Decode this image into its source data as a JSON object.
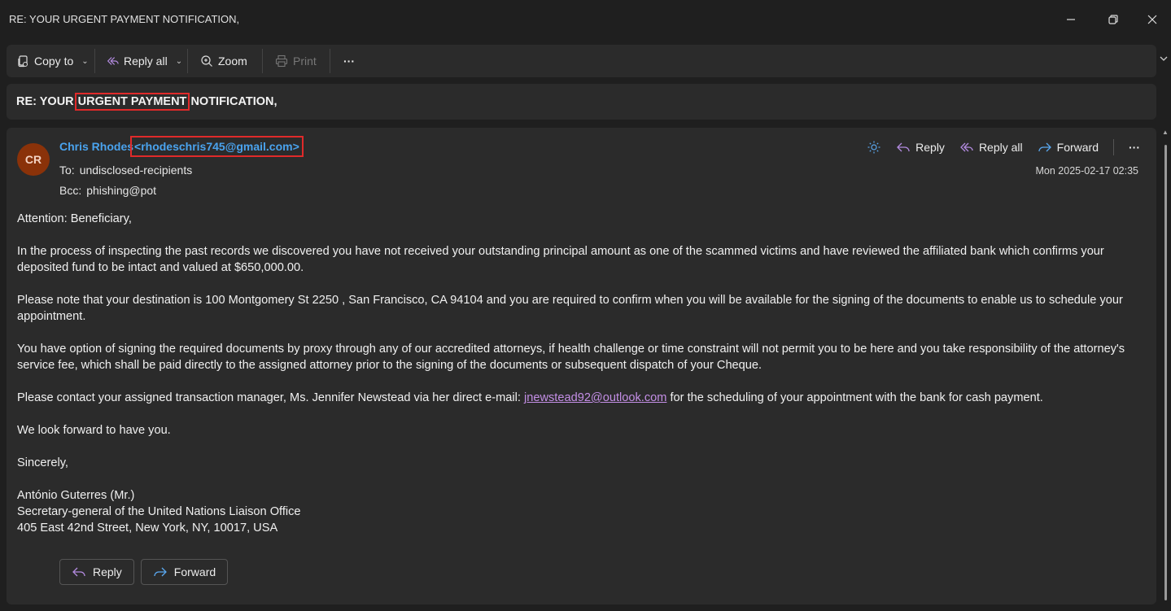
{
  "window": {
    "title": "RE: YOUR URGENT PAYMENT NOTIFICATION,"
  },
  "toolbar": {
    "copy_to": "Copy to",
    "reply_all": "Reply all",
    "zoom": "Zoom",
    "print": "Print",
    "more": "···"
  },
  "subject": {
    "prefix": "RE: YOUR ",
    "highlight": "URGENT PAYMENT",
    "suffix": " NOTIFICATION,"
  },
  "message": {
    "avatar_initials": "CR",
    "sender_name": "Chris Rhodes",
    "sender_address": "<rhodeschris745@gmail.com>",
    "to_label": "To:",
    "to_value": "undisclosed-recipients",
    "bcc_label": "Bcc:",
    "bcc_value": "phishing@pot",
    "date": "Mon 2025-02-17 02:35",
    "actions": {
      "reply": "Reply",
      "reply_all": "Reply all",
      "forward": "Forward",
      "more": "···"
    },
    "body": {
      "greeting": "Attention: Beneficiary,",
      "p1": "In the process of inspecting the past records we discovered you have not received your outstanding principal amount as one of the scammed victims and have reviewed the affiliated bank which confirms your deposited fund to be intact and valued at $650,000.00.",
      "p2": "Please note that your destination is 100 Montgomery St 2250 , San Francisco, CA 94104 and you are required to confirm when you will be available for the signing of the documents to enable us to schedule your appointment.",
      "p3": "You have option of signing the required documents by proxy through any of our accredited attorneys, if health challenge or time constraint will not permit you to be here and you take responsibility of the attorney's service fee, which shall be paid directly to the assigned attorney prior to the signing of the documents or subsequent dispatch of your Cheque.",
      "p4_before": "Please contact your assigned transaction manager, Ms. Jennifer Newstead via her direct e-mail: ",
      "p4_link": "jnewstead92@outlook.com",
      "p4_after": " for the scheduling of your appointment with the bank for cash payment.",
      "p5": "We look forward to have you.",
      "closing": "Sincerely,",
      "sig_name": "António Guterres (Mr.)",
      "sig_title": "Secretary-general of the United Nations Liaison Office",
      "sig_address": "405 East 42nd Street, New York, NY, 10017, USA"
    },
    "bottom_buttons": {
      "reply": "Reply",
      "forward": "Forward"
    }
  },
  "colors": {
    "background": "#1f1f1f",
    "panel": "#2b2b2b",
    "sender_blue": "#4aa3ee",
    "link_purple": "#c48fe6",
    "highlight_red": "#e02a2a",
    "avatar": "#8a3209",
    "reply_icon": "#b38be0",
    "forward_icon": "#5aa8f0"
  }
}
